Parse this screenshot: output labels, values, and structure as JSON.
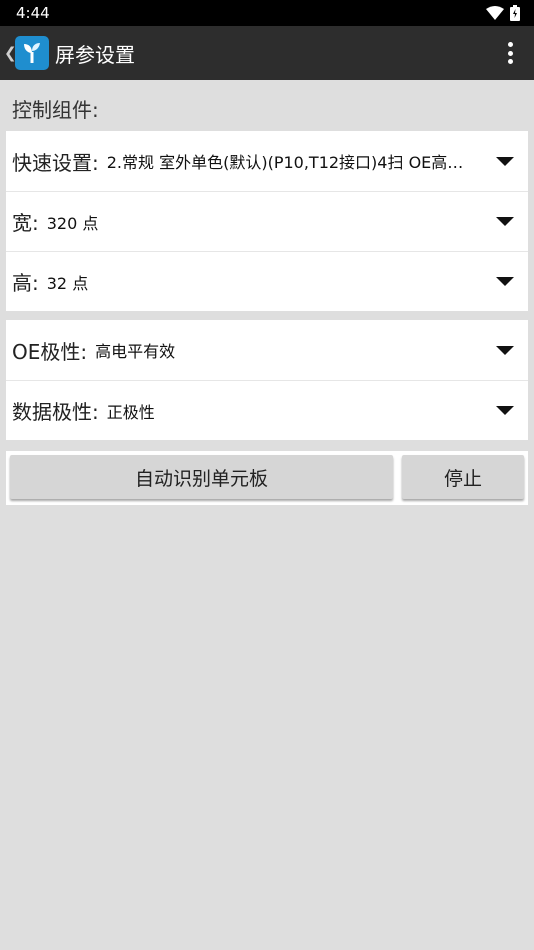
{
  "status": {
    "time": "4:44"
  },
  "appbar": {
    "title": "屏参设置"
  },
  "section": {
    "title": "控制组件:"
  },
  "rows": [
    {
      "label": "快速设置:",
      "value": "2.常规 室外单色(默认)(P10,T12接口)4扫 OE高…"
    },
    {
      "label": "宽:",
      "value": "320 点"
    },
    {
      "label": "高:",
      "value": "32 点"
    },
    {
      "label": "OE极性:",
      "value": "高电平有效"
    },
    {
      "label": "数据极性:",
      "value": "正极性"
    }
  ],
  "buttons": {
    "auto_detect": "自动识别单元板",
    "stop": "停止"
  },
  "colors": {
    "appbar": "#2d2d2d",
    "background": "#dedede",
    "logo": "#1f8ecf"
  }
}
